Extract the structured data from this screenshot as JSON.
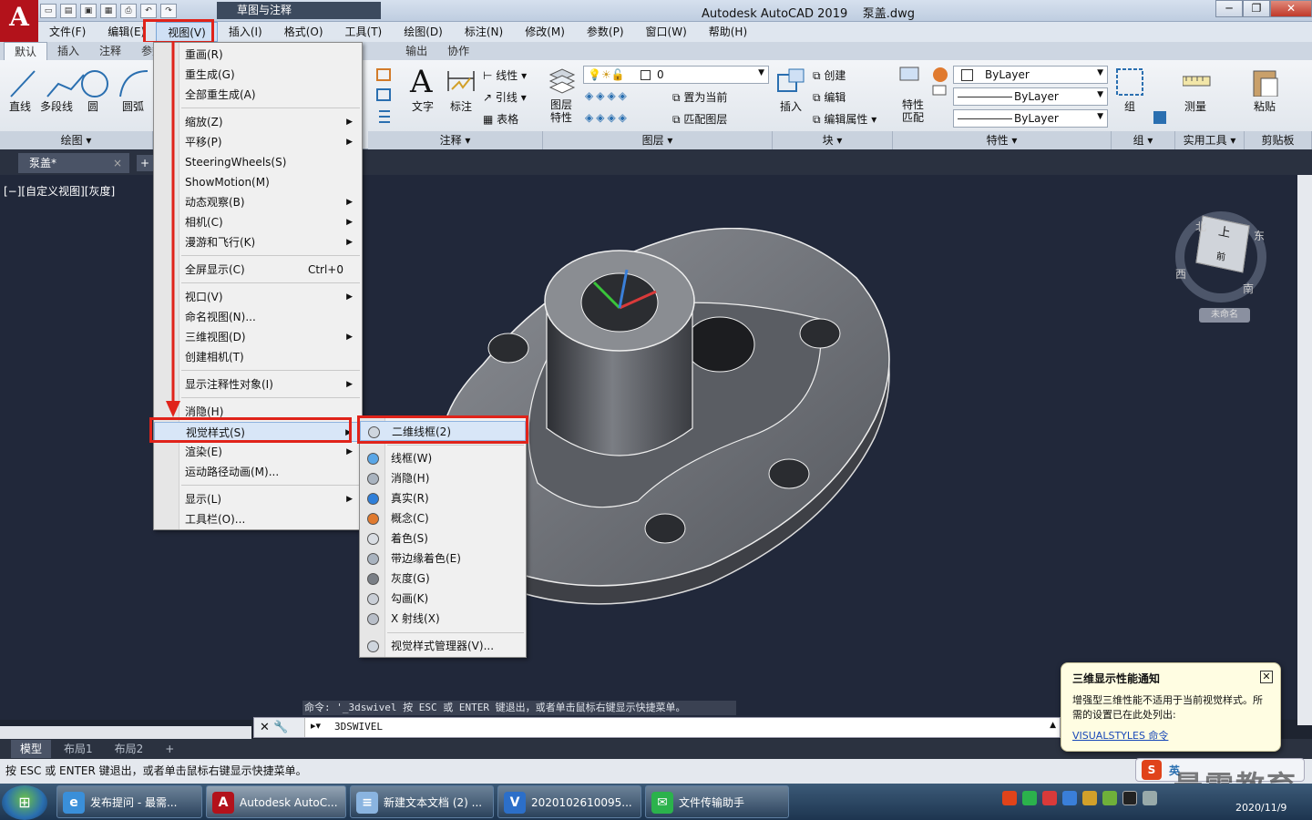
{
  "app": {
    "title": "Autodesk AutoCAD 2019",
    "document": "泵盖.dwg",
    "logo_letter": "A",
    "workspace": "草图与注释"
  },
  "window_buttons": {
    "minimize": "─",
    "restore": "❐",
    "close": "✕"
  },
  "menubar": [
    "文件(F)",
    "编辑(E)",
    "视图(V)",
    "插入(I)",
    "格式(O)",
    "工具(T)",
    "绘图(D)",
    "标注(N)",
    "修改(M)",
    "参数(P)",
    "窗口(W)",
    "帮助(H)"
  ],
  "ribbon_tabs": [
    "默认",
    "插入",
    "注释",
    "参数",
    "输出",
    "协作"
  ],
  "ribbon": {
    "draw_tools": [
      "直线",
      "多段线",
      "圆",
      "圆弧"
    ],
    "draw_panel": "绘图",
    "text_btn": "文字",
    "dim_btn": "标注",
    "line_type": "线性",
    "leader": "引线",
    "table": "表格",
    "annot_panel": "注释",
    "layer_props": "图层特性",
    "layer_value": "0",
    "make_current": "置为当前",
    "match_layer": "匹配图层",
    "layer_panel": "图层",
    "insert_btn": "插入",
    "create": "创建",
    "edit": "编辑",
    "edit_attr": "编辑属性",
    "block_panel": "块",
    "match_props": "特性匹配",
    "bylayer": [
      "ByLayer",
      "ByLayer",
      "ByLayer"
    ],
    "props_panel": "特性",
    "group_btn": "组",
    "group_panel": "组",
    "measure_btn": "测量",
    "util_panel": "实用工具",
    "paste_btn": "粘贴",
    "clip_panel": "剪贴板"
  },
  "doc_tab": {
    "label": "泵盖*",
    "close": "×",
    "add": "+"
  },
  "viewport_label": "[−][自定义视图][灰度]",
  "viewcube": {
    "top": "上",
    "front": "前",
    "north": "北",
    "south": "南",
    "west": "西",
    "east": "东",
    "wcs": "未命名"
  },
  "view_menu": {
    "items": [
      {
        "label": "重画(R)"
      },
      {
        "label": "重生成(G)"
      },
      {
        "label": "全部重生成(A)"
      },
      {
        "label": "缩放(Z)",
        "sub": true
      },
      {
        "label": "平移(P)",
        "sub": true
      },
      {
        "label": "SteeringWheels(S)"
      },
      {
        "label": "ShowMotion(M)"
      },
      {
        "label": "动态观察(B)",
        "sub": true
      },
      {
        "label": "相机(C)",
        "sub": true
      },
      {
        "label": "漫游和飞行(K)",
        "sub": true
      },
      {
        "label": "全屏显示(C)",
        "shortcut": "Ctrl+0"
      },
      {
        "label": "视口(V)",
        "sub": true
      },
      {
        "label": "命名视图(N)..."
      },
      {
        "label": "三维视图(D)",
        "sub": true
      },
      {
        "label": "创建相机(T)"
      },
      {
        "label": "显示注释性对象(I)",
        "sub": true
      },
      {
        "label": "消隐(H)"
      },
      {
        "label": "视觉样式(S)",
        "sub": true
      },
      {
        "label": "渲染(E)",
        "sub": true
      },
      {
        "label": "运动路径动画(M)..."
      },
      {
        "label": "显示(L)",
        "sub": true
      },
      {
        "label": "工具栏(O)..."
      }
    ]
  },
  "visual_styles_menu": {
    "items": [
      "二维线框(2)",
      "线框(W)",
      "消隐(H)",
      "真实(R)",
      "概念(C)",
      "着色(S)",
      "带边缘着色(E)",
      "灰度(G)",
      "勾画(K)",
      "X 射线(X)",
      "视觉样式管理器(V)..."
    ],
    "icon_colors": [
      "#cfd6de",
      "#5aa6e6",
      "#a9b3bf",
      "#2f7fd9",
      "#e07a2f",
      "#d9dde3",
      "#a9b3bf",
      "#7a7f86",
      "#c9ced6",
      "#b8bec8",
      "#cfd6de"
    ]
  },
  "command_history": "命令: '_3dswivel 按 ESC 或 ENTER 键退出，或者单击鼠标右键显示快捷菜单。",
  "command_input": "3DSWIVEL",
  "layout_tabs": [
    "模型",
    "布局1",
    "布局2",
    "+"
  ],
  "status_text": "按 ESC 或 ENTER 键退出，或者单击鼠标右键显示快捷菜单。",
  "notice": {
    "title": "三维显示性能通知",
    "body": "增强型三维性能不适用于当前视觉样式。所需的设置已在此处列出:",
    "link": "VISUALSTYLES 命令",
    "close": "✕"
  },
  "ime": {
    "label": "英"
  },
  "taskbar": {
    "items": [
      {
        "label": "发布提问 - 最需...",
        "icon": "e",
        "color": "#3a8fd9"
      },
      {
        "label": "Autodesk AutoC...",
        "icon": "A",
        "color": "#b3121b"
      },
      {
        "label": "新建文本文档 (2) ...",
        "icon": "≡",
        "color": "#8ab4e0"
      },
      {
        "label": "2020102610095...",
        "icon": "V",
        "color": "#2c6fc9"
      },
      {
        "label": "文件传输助手",
        "icon": "✉",
        "color": "#2bb24c"
      }
    ],
    "date": "2020/11/9"
  },
  "watermark": "最需教育",
  "colors": {
    "accent_red": "#e0231a",
    "canvas": "#21283a",
    "autocad_red": "#b3121b"
  }
}
